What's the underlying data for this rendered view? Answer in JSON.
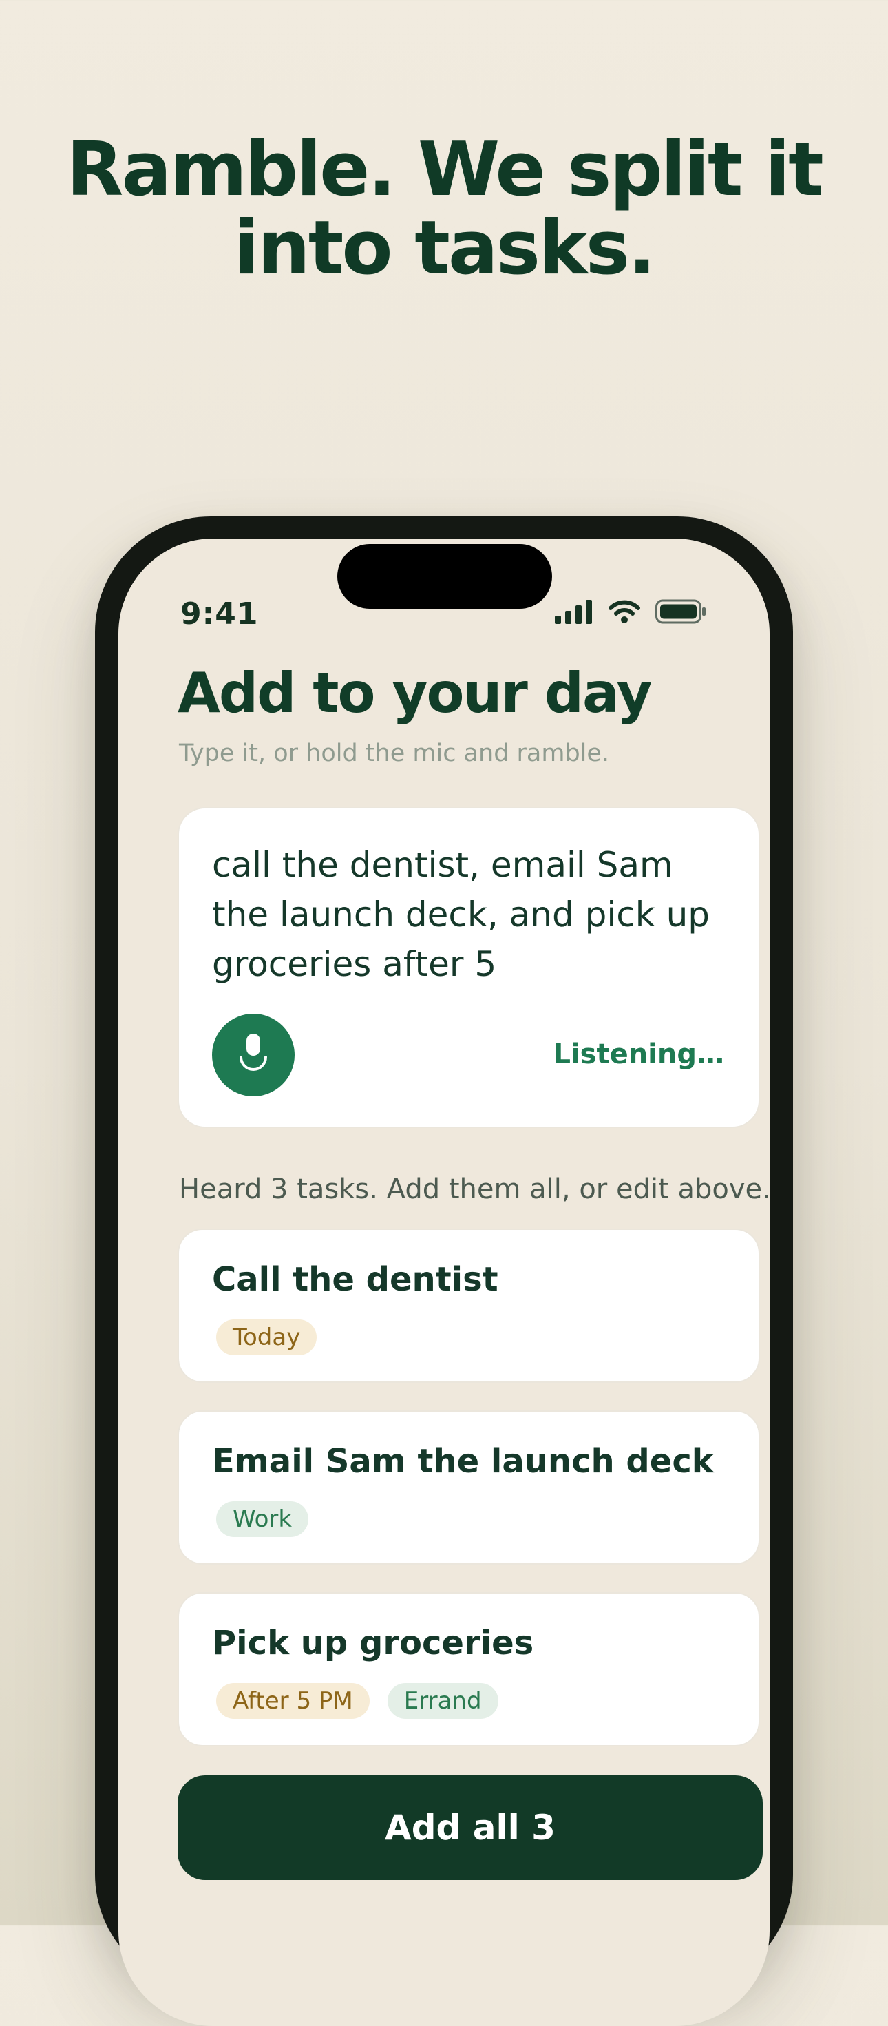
{
  "headline": {
    "line1": "Ramble. We split it",
    "line2": "into tasks."
  },
  "status_bar": {
    "time": "9:41",
    "icons": [
      "cellular-signal-icon",
      "wifi-icon",
      "battery-icon"
    ]
  },
  "screen": {
    "title": "Add to your day",
    "subtitle": "Type it, or hold the mic and ramble."
  },
  "input_card": {
    "text": "call the dentist, email Sam the launch deck, and pick up groceries after 5",
    "mic_icon": "microphone-icon",
    "status": "Listening…"
  },
  "heard_summary": "Heard 3 tasks. Add them all, or edit above.",
  "tasks": [
    {
      "title": "Call the dentist",
      "tags": [
        {
          "label": "Today",
          "style": "amber"
        }
      ]
    },
    {
      "title": "Email Sam the launch deck",
      "tags": [
        {
          "label": "Work",
          "style": "green"
        }
      ]
    },
    {
      "title": "Pick up groceries",
      "tags": [
        {
          "label": "After 5 PM",
          "style": "amber"
        },
        {
          "label": "Errand",
          "style": "green"
        }
      ]
    }
  ],
  "add_all_button": "Add all 3",
  "colors": {
    "brand_dark": "#123a27",
    "brand_green": "#1e7a52",
    "background": "#efe8dc",
    "tag_amber_bg": "#f7ecd6",
    "tag_amber_text": "#8d6518",
    "tag_green_bg": "#e4efe7",
    "tag_green_text": "#2a7a50"
  }
}
